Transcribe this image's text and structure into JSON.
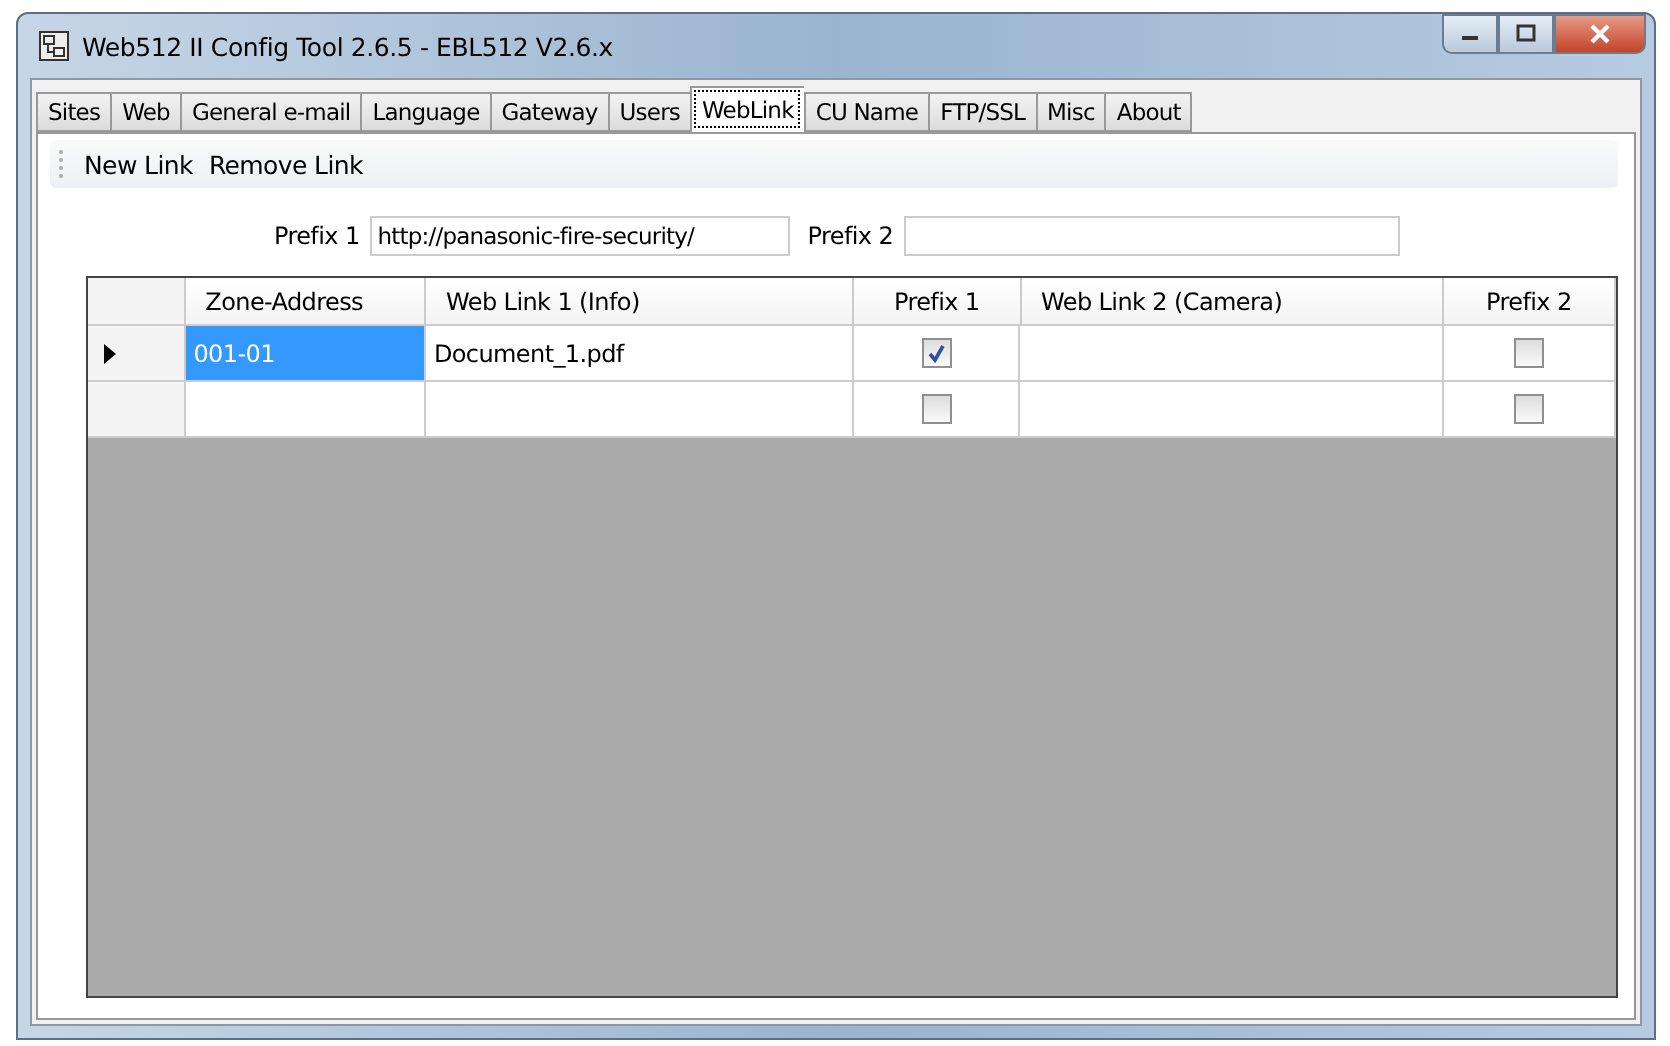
{
  "window": {
    "title": "Web512 II Config Tool 2.6.5 - EBL512 V2.6.x"
  },
  "tabs": [
    {
      "label": "Sites",
      "selected": false
    },
    {
      "label": "Web",
      "selected": false
    },
    {
      "label": "General e-mail",
      "selected": false
    },
    {
      "label": "Language",
      "selected": false
    },
    {
      "label": "Gateway",
      "selected": false
    },
    {
      "label": "Users",
      "selected": false
    },
    {
      "label": "WebLink",
      "selected": true
    },
    {
      "label": "CU Name",
      "selected": false
    },
    {
      "label": "FTP/SSL",
      "selected": false
    },
    {
      "label": "Misc",
      "selected": false
    },
    {
      "label": "About",
      "selected": false
    }
  ],
  "toolbar": [
    "New Link",
    "Remove Link"
  ],
  "prefix_1": {
    "label": "Prefix 1",
    "value": "http://panasonic-fire-security/"
  },
  "prefix_2": {
    "label": "Prefix 2"
  },
  "table": {
    "columns": [
      "Zone-Address",
      "Web Link 1 (Info)",
      "Prefix 1",
      "Web Link 2 (Camera)",
      "Prefix 2"
    ],
    "rows": [
      {
        "selected": true,
        "zone_address": "001-01",
        "web_link_1": "Document_1.pdf",
        "prefix_1": true,
        "prefix_2": false
      },
      {
        "selected": false,
        "prefix_1": false,
        "prefix_2": false
      }
    ]
  }
}
